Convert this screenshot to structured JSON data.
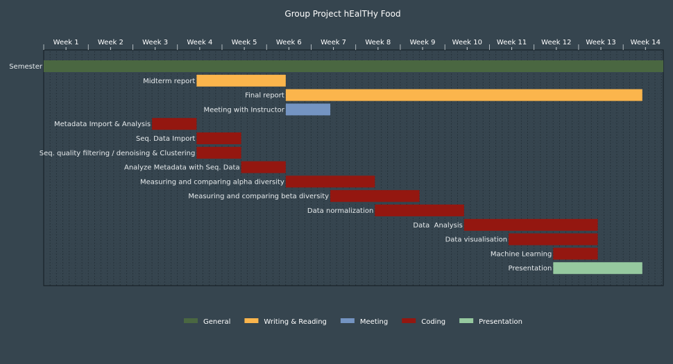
{
  "chart_data": {
    "type": "gantt",
    "title": "Group Project hEalTHy Food",
    "week_labels": [
      "Week 1",
      "Week 2",
      "Week 3",
      "Week 4",
      "Week 5",
      "Week 6",
      "Week 7",
      "Week 8",
      "Week 9",
      "Week 10",
      "Week 11",
      "Week 12",
      "Week 13",
      "Week 14"
    ],
    "x_range_weeks": [
      0.5,
      14.4
    ],
    "grid": true,
    "legend_position": "bottom",
    "categories": [
      {
        "name": "General",
        "color": "#4a6741"
      },
      {
        "name": "Writing & Reading",
        "color": "#fbb54c"
      },
      {
        "name": "Meeting",
        "color": "#7494c2"
      },
      {
        "name": "Coding",
        "color": "#941710"
      },
      {
        "name": "Presentation",
        "color": "#96c99f"
      }
    ],
    "tasks": [
      {
        "label": "Semester",
        "category": "General",
        "start": 0.5,
        "end": 14.4
      },
      {
        "label": "Midterm report",
        "category": "Writing & Reading",
        "start": 3.93,
        "end": 5.93
      },
      {
        "label": "Final report",
        "category": "Writing & Reading",
        "start": 5.93,
        "end": 13.93
      },
      {
        "label": "Meeting with Instructor",
        "category": "Meeting",
        "start": 5.93,
        "end": 6.93
      },
      {
        "label": "Metadata Import & Analysis",
        "category": "Coding",
        "start": 2.93,
        "end": 3.93
      },
      {
        "label": "Seq. Data Import",
        "category": "Coding",
        "start": 3.93,
        "end": 4.93
      },
      {
        "label": "Seq. quality filtering / denoising & Clustering",
        "category": "Coding",
        "start": 3.93,
        "end": 4.93
      },
      {
        "label": "Analyze Metadata with Seq. Data",
        "category": "Coding",
        "start": 4.93,
        "end": 5.93
      },
      {
        "label": "Measuring and comparing alpha diversity",
        "category": "Coding",
        "start": 5.93,
        "end": 7.93
      },
      {
        "label": "Measuring and comparing beta diversity",
        "category": "Coding",
        "start": 6.93,
        "end": 8.93
      },
      {
        "label": "Data normalization",
        "category": "Coding",
        "start": 7.93,
        "end": 9.93
      },
      {
        "label": "Data  Analysis",
        "category": "Coding",
        "start": 9.93,
        "end": 12.93
      },
      {
        "label": "Data visualisation",
        "category": "Coding",
        "start": 10.93,
        "end": 12.93
      },
      {
        "label": "Machine Learning",
        "category": "Coding",
        "start": 11.93,
        "end": 12.93
      },
      {
        "label": "Presentation",
        "category": "Presentation",
        "start": 11.93,
        "end": 13.93
      }
    ]
  }
}
